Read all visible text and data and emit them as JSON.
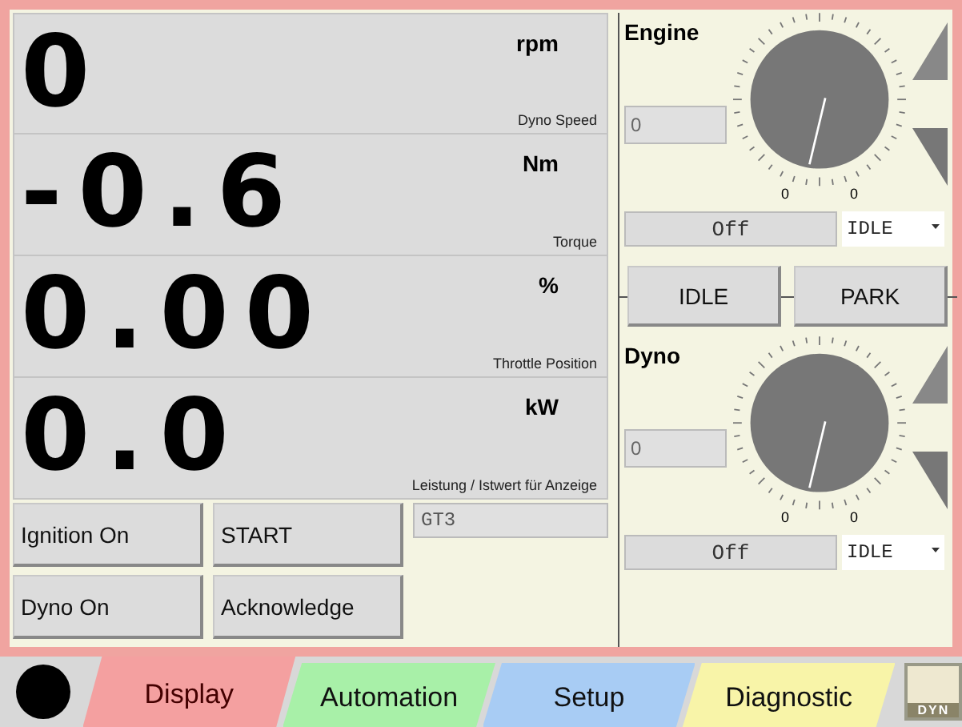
{
  "readouts": [
    {
      "value": "0",
      "unit": "rpm",
      "caption": "Dyno Speed"
    },
    {
      "value": "-0.6",
      "unit": "Nm",
      "caption": "Torque"
    },
    {
      "value": "0.00",
      "unit": "%",
      "caption": "Throttle Position"
    },
    {
      "value": "0.0",
      "unit": "kW",
      "caption": "Leistung / Istwert für Anzeige"
    }
  ],
  "buttons": [
    "Ignition On",
    "START",
    "Dyno On",
    "Acknowledge"
  ],
  "profile_field": {
    "value": "GT3"
  },
  "engine": {
    "title": "Engine",
    "setpoint": "0",
    "gauge_labels": [
      "0",
      "0"
    ],
    "status": "Off",
    "mode": "IDLE"
  },
  "mode_buttons": [
    "IDLE",
    "PARK"
  ],
  "dyno": {
    "title": "Dyno",
    "setpoint": "0",
    "gauge_labels": [
      "0",
      "0"
    ],
    "status": "Off",
    "mode": "IDLE"
  },
  "tabs": [
    {
      "label": "Display",
      "selected": true,
      "color": "#f4a0a0"
    },
    {
      "label": "Automation",
      "selected": false,
      "color": "#a8f0a8"
    },
    {
      "label": "Setup",
      "selected": false,
      "color": "#a8ccf4"
    },
    {
      "label": "Diagnostic",
      "selected": false,
      "color": "#f8f4a8"
    }
  ],
  "logo": {
    "text": "DYN"
  }
}
